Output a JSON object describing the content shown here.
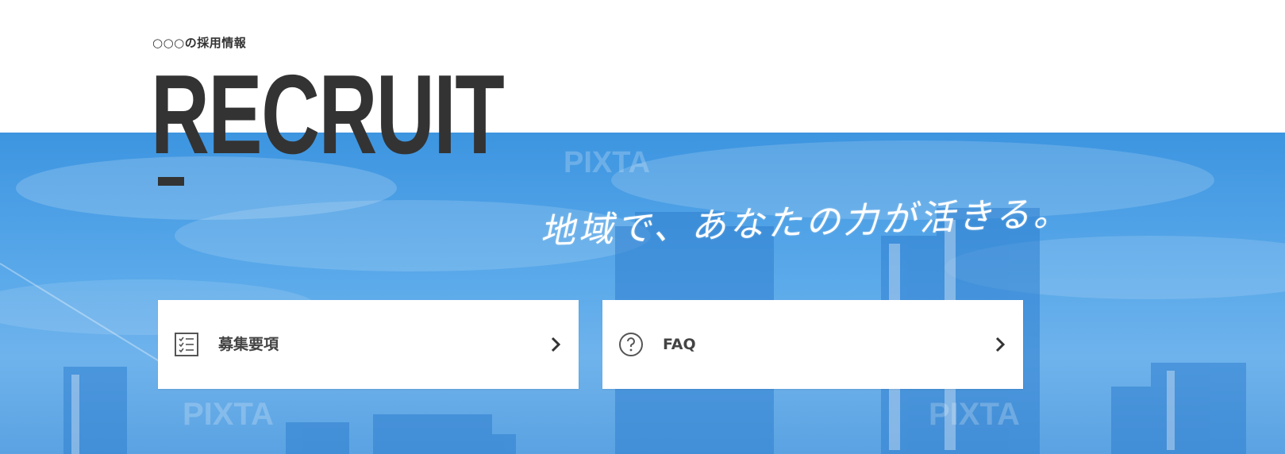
{
  "header": {
    "eyebrow": "○○○の採用情報",
    "title": "RECRUIT"
  },
  "hero": {
    "catchphrase": "地域で、あなたの力が活きる。",
    "watermark": "PIXTA"
  },
  "nav_cards": [
    {
      "label": "募集要項",
      "icon": "checklist-icon"
    },
    {
      "label": "FAQ",
      "icon": "question-circle-icon"
    }
  ],
  "colors": {
    "text_dark": "#333333",
    "hero_blue": "#4a9ee6",
    "card_bg": "#ffffff"
  }
}
